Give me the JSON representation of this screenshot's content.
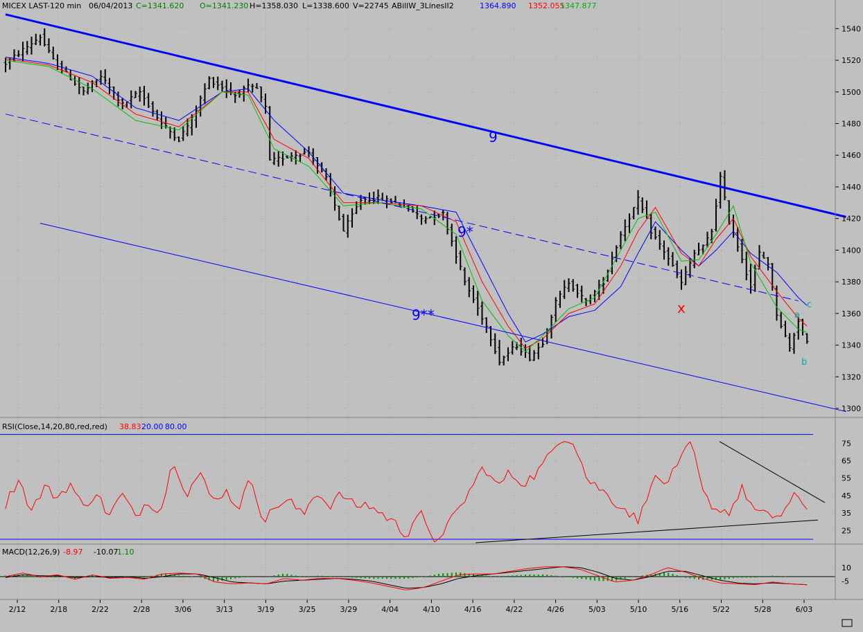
{
  "header": {
    "title": "MICEX LAST-120 min",
    "date": "06/04/2013",
    "close": "C=1341.620",
    "open": "O=1341.230",
    "high": "H=1358.030",
    "low": "L=1338.600",
    "volume": "V=22745",
    "indicator": "ABillW_3LinesII2",
    "ind_blue": "1364.890",
    "ind_red": "1352.055",
    "ind_green": "1347.877"
  },
  "rsi_header": {
    "label": "RSI(Close,14,20,80,red,red)",
    "value": "38.83",
    "lower": "20.00",
    "upper": "80.00"
  },
  "macd_header": {
    "label": "MACD(12,26,9)",
    "macd": "-8.97",
    "signal": "-10.07",
    "hist": "1.10"
  },
  "annotations": {
    "wave9": "9",
    "wave9star": "9*",
    "wave9dstar": "9**",
    "x": "x",
    "a": "a",
    "b": "b",
    "c": "c"
  },
  "colors": {
    "background": "#c0c0c0",
    "price": "#000000",
    "blue_line": "#0000ff",
    "red_line": "#ff0000",
    "green_line": "#00c000",
    "trend": "#0000ff",
    "rsi": "#ff0000",
    "hist": "#009900"
  },
  "chart_data": [
    {
      "type": "candlestick",
      "title": "MICEX LAST-120 min",
      "ylim": [
        1282,
        1552
      ],
      "y_ticks": [
        1300,
        1320,
        1340,
        1360,
        1380,
        1400,
        1420,
        1440,
        1460,
        1480,
        1500,
        1520,
        1540
      ],
      "x_tick_labels": [
        "2/12",
        "2/18",
        "2/22",
        "2/28",
        "3/06",
        "3/13",
        "3/19",
        "3/25",
        "3/29",
        "4/04",
        "4/10",
        "4/16",
        "4/22",
        "4/26",
        "5/03",
        "5/10",
        "5/16",
        "5/22",
        "5/28",
        "6/03"
      ],
      "price_path": [
        [
          0,
          1518
        ],
        [
          8,
          1535
        ],
        [
          11,
          1520
        ],
        [
          18,
          1500
        ],
        [
          22,
          1510
        ],
        [
          27,
          1492
        ],
        [
          31,
          1500
        ],
        [
          36,
          1480
        ],
        [
          40,
          1470
        ],
        [
          43,
          1483
        ],
        [
          47,
          1508
        ],
        [
          53,
          1498
        ],
        [
          56,
          1503
        ],
        [
          58,
          1502
        ],
        [
          60,
          1490
        ],
        [
          61,
          1456
        ],
        [
          66,
          1460
        ],
        [
          70,
          1462
        ],
        [
          74,
          1445
        ],
        [
          78,
          1412
        ],
        [
          82,
          1432
        ],
        [
          86,
          1433
        ],
        [
          90,
          1430
        ],
        [
          93,
          1427
        ],
        [
          96,
          1420
        ],
        [
          101,
          1423
        ],
        [
          106,
          1380
        ],
        [
          111,
          1352
        ],
        [
          114,
          1330
        ],
        [
          118,
          1340
        ],
        [
          121,
          1332
        ],
        [
          124,
          1342
        ],
        [
          127,
          1367
        ],
        [
          130,
          1380
        ],
        [
          134,
          1367
        ],
        [
          138,
          1380
        ],
        [
          142,
          1410
        ],
        [
          146,
          1432
        ],
        [
          149,
          1412
        ],
        [
          153,
          1395
        ],
        [
          156,
          1379
        ],
        [
          159,
          1398
        ],
        [
          161,
          1402
        ],
        [
          163,
          1412
        ],
        [
          165,
          1446
        ],
        [
          167,
          1418
        ],
        [
          170,
          1395
        ],
        [
          172,
          1377
        ],
        [
          174,
          1398
        ],
        [
          176,
          1392
        ],
        [
          178,
          1360
        ],
        [
          181,
          1338
        ],
        [
          183,
          1356
        ],
        [
          185,
          1341
        ]
      ],
      "ma_blue_path": [
        [
          0,
          1522
        ],
        [
          10,
          1518
        ],
        [
          20,
          1510
        ],
        [
          30,
          1490
        ],
        [
          40,
          1482
        ],
        [
          50,
          1500
        ],
        [
          56,
          1502
        ],
        [
          62,
          1482
        ],
        [
          70,
          1462
        ],
        [
          78,
          1436
        ],
        [
          86,
          1432
        ],
        [
          96,
          1428
        ],
        [
          104,
          1424
        ],
        [
          110,
          1392
        ],
        [
          116,
          1360
        ],
        [
          120,
          1342
        ],
        [
          124,
          1347
        ],
        [
          130,
          1358
        ],
        [
          136,
          1362
        ],
        [
          142,
          1377
        ],
        [
          146,
          1398
        ],
        [
          150,
          1418
        ],
        [
          156,
          1400
        ],
        [
          160,
          1390
        ],
        [
          164,
          1400
        ],
        [
          168,
          1412
        ],
        [
          172,
          1398
        ],
        [
          178,
          1386
        ],
        [
          183,
          1370
        ],
        [
          185,
          1365
        ]
      ],
      "ma_red_path": [
        [
          0,
          1521
        ],
        [
          10,
          1517
        ],
        [
          20,
          1506
        ],
        [
          30,
          1486
        ],
        [
          40,
          1478
        ],
        [
          50,
          1500
        ],
        [
          56,
          1500
        ],
        [
          62,
          1470
        ],
        [
          70,
          1458
        ],
        [
          78,
          1430
        ],
        [
          86,
          1430
        ],
        [
          96,
          1428
        ],
        [
          104,
          1418
        ],
        [
          110,
          1380
        ],
        [
          116,
          1352
        ],
        [
          120,
          1338
        ],
        [
          124,
          1344
        ],
        [
          130,
          1360
        ],
        [
          136,
          1366
        ],
        [
          142,
          1390
        ],
        [
          146,
          1412
        ],
        [
          150,
          1427
        ],
        [
          156,
          1398
        ],
        [
          160,
          1390
        ],
        [
          164,
          1407
        ],
        [
          168,
          1420
        ],
        [
          172,
          1396
        ],
        [
          178,
          1374
        ],
        [
          183,
          1357
        ],
        [
          185,
          1352
        ]
      ],
      "ma_green_path": [
        [
          0,
          1520
        ],
        [
          10,
          1516
        ],
        [
          20,
          1502
        ],
        [
          30,
          1482
        ],
        [
          40,
          1476
        ],
        [
          50,
          1500
        ],
        [
          56,
          1498
        ],
        [
          62,
          1464
        ],
        [
          70,
          1453
        ],
        [
          78,
          1428
        ],
        [
          86,
          1430
        ],
        [
          96,
          1426
        ],
        [
          104,
          1410
        ],
        [
          110,
          1368
        ],
        [
          116,
          1346
        ],
        [
          120,
          1336
        ],
        [
          124,
          1346
        ],
        [
          130,
          1363
        ],
        [
          136,
          1370
        ],
        [
          142,
          1400
        ],
        [
          146,
          1420
        ],
        [
          150,
          1424
        ],
        [
          156,
          1393
        ],
        [
          160,
          1394
        ],
        [
          164,
          1410
        ],
        [
          168,
          1428
        ],
        [
          172,
          1392
        ],
        [
          178,
          1364
        ],
        [
          183,
          1350
        ],
        [
          185,
          1348
        ]
      ],
      "trend_lines": [
        {
          "label": "9",
          "style": "solid-thick",
          "from": [
            0,
            1549
          ],
          "to": [
            194,
            1421
          ]
        },
        {
          "label": "9*",
          "style": "dashed",
          "from": [
            0,
            1486
          ],
          "to": [
            183,
            1368
          ]
        },
        {
          "label": "9**",
          "style": "solid-thin",
          "from": [
            8,
            1417
          ],
          "to": [
            194,
            1298
          ]
        }
      ]
    },
    {
      "type": "line",
      "title": "RSI(Close,14,20,80,red,red)",
      "ylim": [
        17,
        84
      ],
      "y_ticks": [
        25,
        35,
        45,
        55,
        65,
        75
      ],
      "levels": [
        20,
        80
      ],
      "series": [
        {
          "name": "RSI",
          "values": [
            40,
            55,
            36,
            50,
            44,
            52,
            38,
            47,
            33,
            46,
            33,
            42,
            36,
            66,
            46,
            58,
            42,
            48,
            38,
            55,
            30,
            40,
            42,
            33,
            48,
            39,
            46,
            39,
            40,
            35,
            30,
            22,
            37,
            18,
            26,
            36,
            49,
            62,
            50,
            58,
            52,
            57,
            67,
            79,
            76,
            54,
            49,
            42,
            37,
            30,
            55,
            52,
            61,
            76,
            45,
            37,
            36,
            49,
            36,
            33,
            34,
            44,
            39
          ]
        }
      ]
    },
    {
      "type": "line",
      "title": "MACD(12,26,9)",
      "ylim": [
        -16,
        19
      ],
      "y_ticks": [
        -5,
        10
      ],
      "series": [
        {
          "name": "MACD",
          "values": [
            0,
            4,
            0,
            2,
            -3,
            2,
            -2,
            -1,
            -3,
            3,
            4,
            3,
            -6,
            -8,
            -7,
            -8,
            -2,
            -4,
            -2,
            -2,
            -4,
            -7,
            -11,
            -15,
            -12,
            -5,
            2,
            3,
            3,
            6,
            9,
            11,
            11,
            8,
            1,
            -6,
            -4,
            2,
            10,
            5,
            -2,
            -7,
            -8,
            -9,
            -6,
            -8,
            -9
          ]
        },
        {
          "name": "Signal",
          "values": [
            -1,
            2,
            1,
            1,
            -1,
            0,
            -1,
            0,
            -2,
            0,
            3,
            3,
            -1,
            -6,
            -7,
            -8,
            -5,
            -4,
            -3,
            -2,
            -3,
            -5,
            -9,
            -13,
            -12,
            -8,
            -2,
            1,
            3,
            5,
            7,
            9,
            11,
            10,
            5,
            -2,
            -4,
            0,
            6,
            6,
            1,
            -4,
            -7,
            -8,
            -7,
            -8,
            -9
          ]
        }
      ]
    }
  ]
}
